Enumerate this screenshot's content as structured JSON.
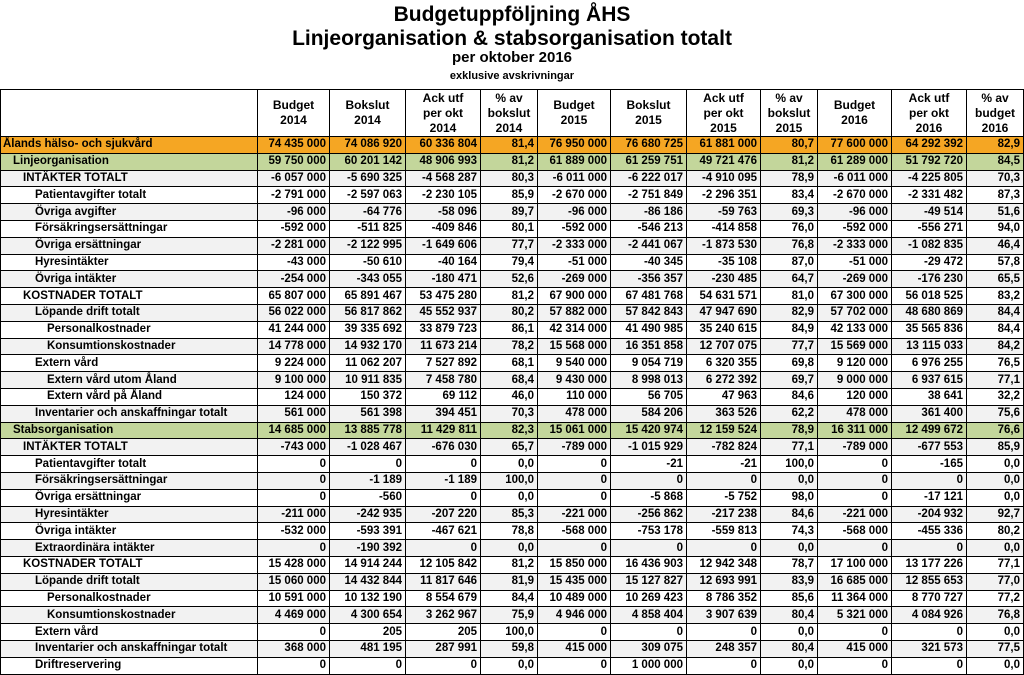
{
  "title": "Budgetuppföljning ÅHS",
  "subtitle": "Linjeorganisation & stabsorganisation totalt",
  "period": "per oktober 2016",
  "note": "exklusive avskrivningar",
  "columns": [
    [
      "Budget",
      "2014"
    ],
    [
      "Bokslut",
      "2014"
    ],
    [
      "Ack utf",
      "per okt",
      "2014"
    ],
    [
      "% av",
      "bokslut",
      "2014"
    ],
    [
      "Budget",
      "2015"
    ],
    [
      "Bokslut",
      "2015"
    ],
    [
      "Ack utf",
      "per okt",
      "2015"
    ],
    [
      "% av",
      "bokslut",
      "2015"
    ],
    [
      "Budget",
      "2016"
    ],
    [
      "Ack utf",
      "per okt",
      "2016"
    ],
    [
      "% av",
      "budget",
      "2016"
    ]
  ],
  "rows": [
    {
      "label": "Ålands hälso- och sjukvård",
      "indent": 0,
      "style": "orange",
      "values": [
        "74 435 000",
        "74 086 920",
        "60 336 804",
        "81,4",
        "76 950 000",
        "76 680 725",
        "61 881 000",
        "80,7",
        "77 600 000",
        "64 292 392",
        "82,9"
      ]
    },
    {
      "label": "Linjeorganisation",
      "indent": 1,
      "style": "green",
      "values": [
        "59 750 000",
        "60 201 142",
        "48 906 993",
        "81,2",
        "61 889 000",
        "61 259 751",
        "49 721 476",
        "81,2",
        "61 289 000",
        "51 792 720",
        "84,5"
      ]
    },
    {
      "label": "INTÄKTER TOTALT",
      "indent": 2,
      "style": "alt",
      "values": [
        "-6 057 000",
        "-5 690 325",
        "-4 568 287",
        "80,3",
        "-6 011 000",
        "-6 222 017",
        "-4 910 095",
        "78,9",
        "-6 011 000",
        "-4 225 805",
        "70,3"
      ]
    },
    {
      "label": "Patientavgifter totalt",
      "indent": 3,
      "style": "",
      "values": [
        "-2 791 000",
        "-2 597 063",
        "-2 230 105",
        "85,9",
        "-2 670 000",
        "-2 751 849",
        "-2 296 351",
        "83,4",
        "-2 670 000",
        "-2 331 482",
        "87,3"
      ]
    },
    {
      "label": "Övriga avgifter",
      "indent": 3,
      "style": "alt",
      "values": [
        "-96 000",
        "-64 776",
        "-58 096",
        "89,7",
        "-96 000",
        "-86 186",
        "-59 763",
        "69,3",
        "-96 000",
        "-49 514",
        "51,6"
      ]
    },
    {
      "label": "Försäkringsersättningar",
      "indent": 3,
      "style": "",
      "values": [
        "-592 000",
        "-511 825",
        "-409 846",
        "80,1",
        "-592 000",
        "-546 213",
        "-414 858",
        "76,0",
        "-592 000",
        "-556 271",
        "94,0"
      ]
    },
    {
      "label": "Övriga ersättningar",
      "indent": 3,
      "style": "alt",
      "values": [
        "-2 281 000",
        "-2 122 995",
        "-1 649 606",
        "77,7",
        "-2 333 000",
        "-2 441 067",
        "-1 873 530",
        "76,8",
        "-2 333 000",
        "-1 082 835",
        "46,4"
      ]
    },
    {
      "label": "Hyresintäkter",
      "indent": 3,
      "style": "",
      "values": [
        "-43 000",
        "-50 610",
        "-40 164",
        "79,4",
        "-51 000",
        "-40 345",
        "-35 108",
        "87,0",
        "-51 000",
        "-29 472",
        "57,8"
      ]
    },
    {
      "label": "Övriga intäkter",
      "indent": 3,
      "style": "alt",
      "values": [
        "-254 000",
        "-343 055",
        "-180 471",
        "52,6",
        "-269 000",
        "-356 357",
        "-230 485",
        "64,7",
        "-269 000",
        "-176 230",
        "65,5"
      ]
    },
    {
      "label": "KOSTNADER TOTALT",
      "indent": 2,
      "style": "",
      "values": [
        "65 807 000",
        "65 891 467",
        "53 475 280",
        "81,2",
        "67 900 000",
        "67 481 768",
        "54 631 571",
        "81,0",
        "67 300 000",
        "56 018 525",
        "83,2"
      ]
    },
    {
      "label": "Löpande drift totalt",
      "indent": 3,
      "style": "alt",
      "values": [
        "56 022 000",
        "56 817 862",
        "45 552 937",
        "80,2",
        "57 882 000",
        "57 842 843",
        "47 947 690",
        "82,9",
        "57 702 000",
        "48 680 869",
        "84,4"
      ]
    },
    {
      "label": "Personalkostnader",
      "indent": 4,
      "style": "",
      "values": [
        "41 244 000",
        "39 335 692",
        "33 879 723",
        "86,1",
        "42 314 000",
        "41 490 985",
        "35 240 615",
        "84,9",
        "42 133 000",
        "35 565 836",
        "84,4"
      ]
    },
    {
      "label": "Konsumtionskostnader",
      "indent": 4,
      "style": "alt",
      "values": [
        "14 778 000",
        "14 932 170",
        "11 673 214",
        "78,2",
        "15 568 000",
        "16 351 858",
        "12 707 075",
        "77,7",
        "15 569 000",
        "13 115 033",
        "84,2"
      ]
    },
    {
      "label": "Extern vård",
      "indent": 3,
      "style": "",
      "values": [
        "9 224 000",
        "11 062 207",
        "7 527 892",
        "68,1",
        "9 540 000",
        "9 054 719",
        "6 320 355",
        "69,8",
        "9 120 000",
        "6 976 255",
        "76,5"
      ]
    },
    {
      "label": "Extern vård utom Åland",
      "indent": 4,
      "style": "alt",
      "values": [
        "9 100 000",
        "10 911 835",
        "7 458 780",
        "68,4",
        "9 430 000",
        "8 998 013",
        "6 272 392",
        "69,7",
        "9 000 000",
        "6 937 615",
        "77,1"
      ]
    },
    {
      "label": "Extern vård på Åland",
      "indent": 4,
      "style": "",
      "values": [
        "124 000",
        "150 372",
        "69 112",
        "46,0",
        "110 000",
        "56 705",
        "47 963",
        "84,6",
        "120 000",
        "38 641",
        "32,2"
      ]
    },
    {
      "label": "Inventarier och anskaffningar totalt",
      "indent": 3,
      "style": "alt",
      "values": [
        "561 000",
        "561 398",
        "394 451",
        "70,3",
        "478 000",
        "584 206",
        "363 526",
        "62,2",
        "478 000",
        "361 400",
        "75,6"
      ]
    },
    {
      "label": "Stabsorganisation",
      "indent": 1,
      "style": "green",
      "values": [
        "14 685 000",
        "13 885 778",
        "11 429 811",
        "82,3",
        "15 061 000",
        "15 420 974",
        "12 159 524",
        "78,9",
        "16 311 000",
        "12 499 672",
        "76,6"
      ]
    },
    {
      "label": "INTÄKTER TOTALT",
      "indent": 2,
      "style": "alt",
      "values": [
        "-743 000",
        "-1 028 467",
        "-676 030",
        "65,7",
        "-789 000",
        "-1 015 929",
        "-782 824",
        "77,1",
        "-789 000",
        "-677 553",
        "85,9"
      ]
    },
    {
      "label": "Patientavgifter totalt",
      "indent": 3,
      "style": "",
      "values": [
        "0",
        "0",
        "0",
        "0,0",
        "0",
        "-21",
        "-21",
        "100,0",
        "0",
        "-165",
        "0,0"
      ]
    },
    {
      "label": "Försäkringsersättningar",
      "indent": 3,
      "style": "alt",
      "values": [
        "0",
        "-1 189",
        "-1 189",
        "100,0",
        "0",
        "0",
        "0",
        "0,0",
        "0",
        "0",
        "0,0"
      ]
    },
    {
      "label": "Övriga ersättningar",
      "indent": 3,
      "style": "",
      "values": [
        "0",
        "-560",
        "0",
        "0,0",
        "0",
        "-5 868",
        "-5 752",
        "98,0",
        "0",
        "-17 121",
        "0,0"
      ]
    },
    {
      "label": "Hyresintäkter",
      "indent": 3,
      "style": "alt",
      "values": [
        "-211 000",
        "-242 935",
        "-207 220",
        "85,3",
        "-221 000",
        "-256 862",
        "-217 238",
        "84,6",
        "-221 000",
        "-204 932",
        "92,7"
      ]
    },
    {
      "label": "Övriga intäkter",
      "indent": 3,
      "style": "",
      "values": [
        "-532 000",
        "-593 391",
        "-467 621",
        "78,8",
        "-568 000",
        "-753 178",
        "-559 813",
        "74,3",
        "-568 000",
        "-455 336",
        "80,2"
      ]
    },
    {
      "label": "Extraordinära intäkter",
      "indent": 3,
      "style": "alt",
      "values": [
        "0",
        "-190 392",
        "0",
        "0,0",
        "0",
        "0",
        "0",
        "0,0",
        "0",
        "0",
        "0,0"
      ]
    },
    {
      "label": "KOSTNADER TOTALT",
      "indent": 2,
      "style": "",
      "values": [
        "15 428 000",
        "14 914 244",
        "12 105 842",
        "81,2",
        "15 850 000",
        "16 436 903",
        "12 942 348",
        "78,7",
        "17 100 000",
        "13 177 226",
        "77,1"
      ]
    },
    {
      "label": "Löpande drift totalt",
      "indent": 3,
      "style": "alt",
      "values": [
        "15 060 000",
        "14 432 844",
        "11 817 646",
        "81,9",
        "15 435 000",
        "15 127 827",
        "12 693 991",
        "83,9",
        "16 685 000",
        "12 855 653",
        "77,0"
      ]
    },
    {
      "label": "Personalkostnader",
      "indent": 4,
      "style": "",
      "values": [
        "10 591 000",
        "10 132 190",
        "8 554 679",
        "84,4",
        "10 489 000",
        "10 269 423",
        "8 786 352",
        "85,6",
        "11 364 000",
        "8 770 727",
        "77,2"
      ]
    },
    {
      "label": "Konsumtionskostnader",
      "indent": 4,
      "style": "alt",
      "values": [
        "4 469 000",
        "4 300 654",
        "3 262 967",
        "75,9",
        "4 946 000",
        "4 858 404",
        "3 907 639",
        "80,4",
        "5 321 000",
        "4 084 926",
        "76,8"
      ]
    },
    {
      "label": "Extern vård",
      "indent": 3,
      "style": "",
      "values": [
        "0",
        "205",
        "205",
        "100,0",
        "0",
        "0",
        "0",
        "0,0",
        "0",
        "0",
        "0,0"
      ]
    },
    {
      "label": "Inventarier och anskaffningar totalt",
      "indent": 3,
      "style": "alt",
      "values": [
        "368 000",
        "481 195",
        "287 991",
        "59,8",
        "415 000",
        "309 075",
        "248 357",
        "80,4",
        "415 000",
        "321 573",
        "77,5"
      ]
    },
    {
      "label": "Driftreservering",
      "indent": 3,
      "style": "",
      "values": [
        "0",
        "0",
        "0",
        "0,0",
        "0",
        "1 000 000",
        "0",
        "0,0",
        "0",
        "0",
        "0,0"
      ]
    }
  ]
}
